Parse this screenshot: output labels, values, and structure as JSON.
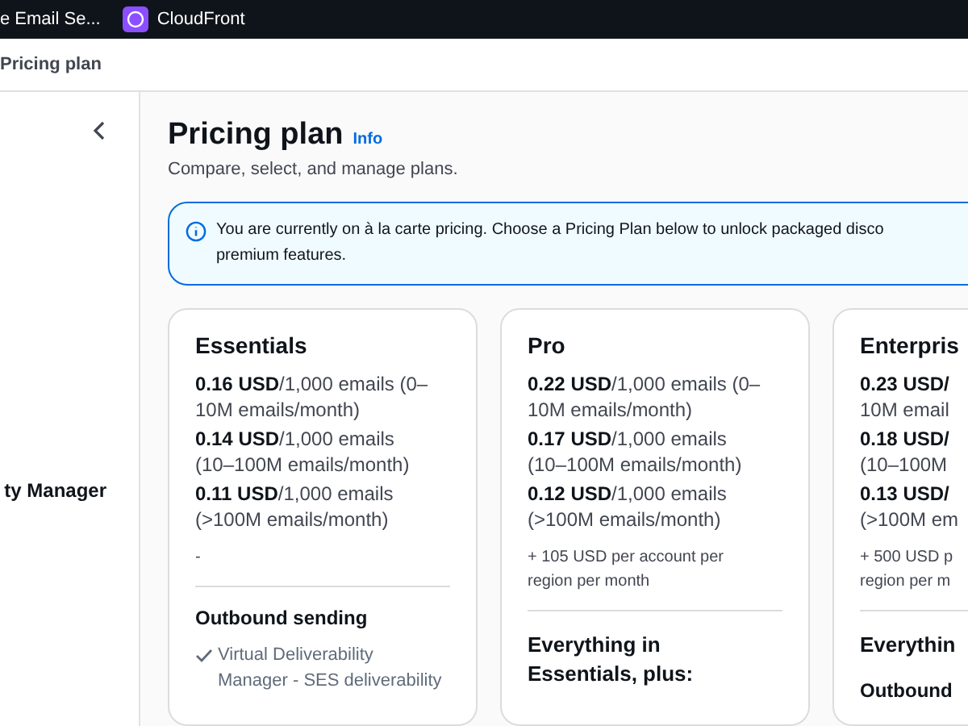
{
  "top_bar": {
    "tabs": [
      {
        "label": "e Email Se...",
        "icon": false
      },
      {
        "label": "CloudFront",
        "icon": true
      }
    ]
  },
  "breadcrumb": "Pricing plan",
  "sidebar": {
    "item": "ty Manager"
  },
  "header": {
    "title": "Pricing plan",
    "info": "Info",
    "subtitle": "Compare, select, and manage plans."
  },
  "alert": "You are currently on à la carte pricing. Choose a Pricing Plan below to unlock packaged disco\npremium features.",
  "plans": [
    {
      "title": "Essentials",
      "prices": [
        "**0.16 USD**/1,000 emails (0–\n10M emails/month)",
        "**0.14 USD**/1,000 emails\n(10–100M emails/month)",
        "**0.11 USD**/1,000 emails\n(>100M emails/month)"
      ],
      "extra": "-",
      "section": "Outbound sending",
      "features": [
        "Virtual Deliverability\nManager - SES deliverability"
      ]
    },
    {
      "title": "Pro",
      "prices": [
        "**0.22 USD**/1,000 emails (0–\n10M emails/month)",
        "**0.17 USD**/1,000 emails\n(10–100M emails/month)",
        "**0.12 USD**/1,000 emails\n(>100M emails/month)"
      ],
      "extra": "+ 105 USD per account per\nregion per month",
      "heading": "Everything in\nEssentials, plus:"
    },
    {
      "title": "Enterpris",
      "prices": [
        "**0.23 USD/**\n10M email",
        "**0.18 USD/**\n(10–100M",
        "**0.13 USD/**\n(>100M em"
      ],
      "extra": "+ 500 USD p\nregion per m",
      "heading": "Everythin",
      "section": "Outbound"
    }
  ]
}
